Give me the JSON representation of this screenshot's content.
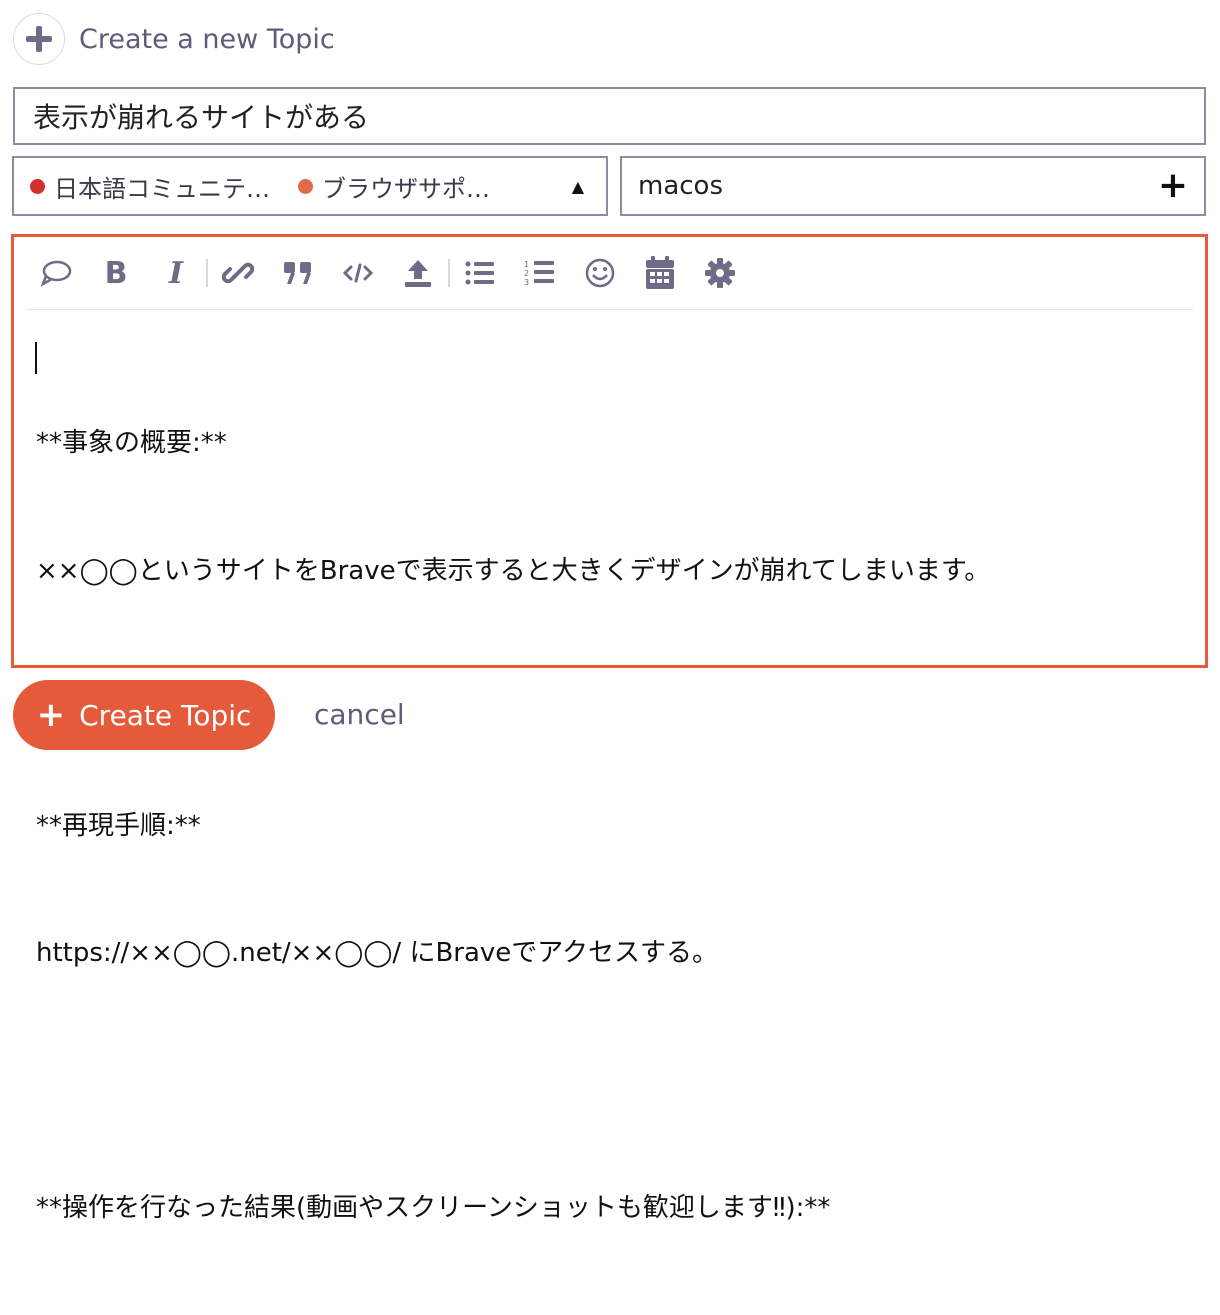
{
  "header": {
    "title": "Create a new Topic",
    "icon": "plus-icon"
  },
  "title_field": {
    "value": "表示が崩れるサイトがある"
  },
  "categories": [
    {
      "label": "日本語コミュニテ…",
      "color": "#d32f2f"
    },
    {
      "label": "ブラウザサポ…",
      "color": "#e06a4a"
    }
  ],
  "tags": {
    "value": "macos"
  },
  "toolbar": {
    "buttons": [
      "quote-icon",
      "bold-icon",
      "italic-icon",
      "link-icon",
      "blockquote-icon",
      "code-icon",
      "upload-icon",
      "bullet-list-icon",
      "numbered-list-icon",
      "emoji-icon",
      "calendar-icon",
      "gear-icon"
    ],
    "bold_label": "B",
    "italic_label": "I"
  },
  "editor": {
    "lines": [
      "**事象の概要:**",
      "××◯◯というサイトをBraveで表示すると大きくデザインが崩れてしまいます。",
      "",
      "**再現手順:**",
      "https://××◯◯.net/××◯◯/ にBraveでアクセスする。",
      "",
      "**操作を行なった結果(動画やスクリーンショットも歓迎します‼):**"
    ]
  },
  "actions": {
    "create_label": "Create Topic",
    "cancel_label": "cancel"
  },
  "colors": {
    "accent": "#e45a3a",
    "border": "#8f8ba6",
    "icon": "#6f6a87"
  }
}
